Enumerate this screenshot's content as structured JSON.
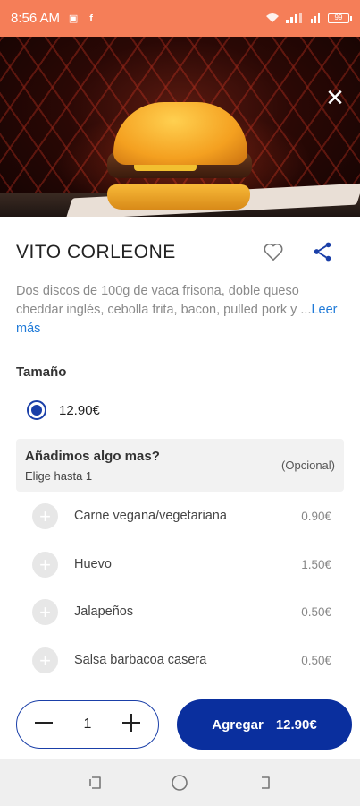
{
  "status_bar": {
    "time": "8:56 AM",
    "battery": "99"
  },
  "product": {
    "title": "VITO CORLEONE",
    "description_visible": "Dos discos de 100g de vaca frisona, doble queso cheddar inglés, cebolla frita, bacon, pulled pork y ...",
    "read_more": "Leer más"
  },
  "size_section": {
    "label": "Tamaño",
    "options": [
      {
        "price": "12.90€",
        "selected": true
      }
    ]
  },
  "extras": {
    "title": "Añadimos algo mas?",
    "subtitle": "Elige hasta 1",
    "optional_label": "(Opcional)",
    "items": [
      {
        "name": "Carne vegana/vegetariana",
        "price": "0.90€"
      },
      {
        "name": "Huevo",
        "price": "1.50€"
      },
      {
        "name": "Jalapeños",
        "price": "0.50€"
      },
      {
        "name": "Salsa barbacoa casera",
        "price": "0.50€"
      }
    ]
  },
  "cart": {
    "quantity": "1",
    "add_label": "Agregar",
    "total": "12.90€"
  },
  "colors": {
    "status_bar": "#f57e58",
    "accent": "#0a2f9e",
    "link": "#1f7ad8"
  }
}
